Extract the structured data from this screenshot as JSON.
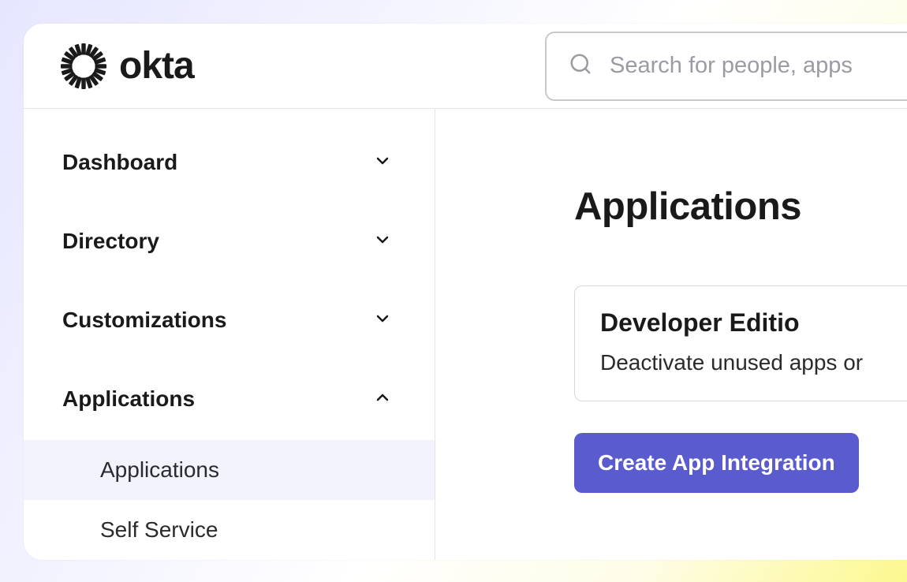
{
  "brand": {
    "name": "okta"
  },
  "search": {
    "placeholder": "Search for people, apps"
  },
  "sidebar": {
    "items": [
      {
        "label": "Dashboard",
        "expanded": false,
        "children": []
      },
      {
        "label": "Directory",
        "expanded": false,
        "children": []
      },
      {
        "label": "Customizations",
        "expanded": false,
        "children": []
      },
      {
        "label": "Applications",
        "expanded": true,
        "children": [
          {
            "label": "Applications",
            "selected": true
          },
          {
            "label": "Self Service",
            "selected": false
          }
        ]
      }
    ]
  },
  "main": {
    "title": "Applications",
    "notice": {
      "title": "Developer Editio",
      "body": "Deactivate unused apps or"
    },
    "primary_button": "Create App Integration"
  },
  "colors": {
    "accent": "#5a5cce",
    "nav_selected_bg": "#f2f3fc"
  }
}
